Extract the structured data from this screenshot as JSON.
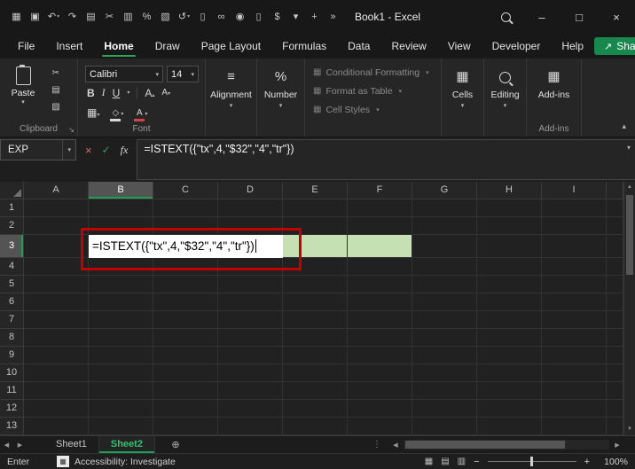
{
  "colors": {
    "accent_green": "#107C41",
    "tab_underline_green": "#2EA158",
    "annotation_red": "#C40000",
    "range_fill_green": "#C6E0B4",
    "share_button_green": "#18894E"
  },
  "ui": {
    "caret_down": "▾",
    "caret_up": "▴",
    "left": "◀",
    "right": "▶",
    "up": "▲",
    "down": "▼",
    "dots": "⋮",
    "launcher": "↘",
    "plus_circle": "⊕",
    "minus": "−",
    "plus": "+",
    "percent": "%",
    "equals": "≡",
    "grid": "▦",
    "border": "▦",
    "diamond": "◇",
    "minimize": "–",
    "maximize": "□",
    "close": "×",
    "share": "↗",
    "view_normal": "▦",
    "view_layout": "▤",
    "view_break": "▥",
    "macro": "▦"
  },
  "title_bar": {
    "title": "Book1 - Excel",
    "quick_access": [
      {
        "name": "app-menu-icon",
        "glyph": "▦"
      },
      {
        "name": "save-icon",
        "glyph": "▣"
      },
      {
        "name": "undo-icon",
        "glyph": "↶",
        "caret": true
      },
      {
        "name": "redo-icon",
        "glyph": "↷"
      },
      {
        "name": "copy-icon",
        "glyph": "▤"
      },
      {
        "name": "cut-icon",
        "glyph": "✂"
      },
      {
        "name": "clipboard-icon",
        "glyph": "▥"
      },
      {
        "name": "percent-icon",
        "glyph": "%"
      },
      {
        "name": "format-painter-icon",
        "glyph": "▧"
      },
      {
        "name": "undo-history-icon",
        "glyph": "↺",
        "caret": true
      },
      {
        "name": "document-icon",
        "glyph": "▯"
      },
      {
        "name": "link-icon",
        "glyph": "∞"
      },
      {
        "name": "camera-icon",
        "glyph": "◉"
      },
      {
        "name": "file-icon",
        "glyph": "▯"
      },
      {
        "name": "currency-icon",
        "glyph": "$"
      },
      {
        "name": "chevron-down-icon",
        "glyph": "▾"
      },
      {
        "name": "add-person-icon",
        "glyph": "+"
      },
      {
        "name": "overflow-icon",
        "glyph": "»"
      }
    ]
  },
  "tabs_row": {
    "tabs": [
      "File",
      "Insert",
      "Home",
      "Draw",
      "Page Layout",
      "Formulas",
      "Data",
      "Review",
      "View",
      "Developer",
      "Help"
    ],
    "active": "Home",
    "share_label": "Share"
  },
  "ribbon": {
    "clipboard": {
      "paste_label": "Paste",
      "caption": "Clipboard",
      "tools": [
        {
          "name": "cut-icon",
          "glyph": "✂"
        },
        {
          "name": "copy-icon",
          "glyph": "▤"
        },
        {
          "name": "format-painter-icon",
          "glyph": "▧"
        }
      ]
    },
    "font": {
      "caption": "Font",
      "font_name": "Calibri",
      "font_size": "14",
      "bold": "B",
      "italic": "I",
      "underline": "U",
      "grow": "A",
      "shrink": "A",
      "color_letter": "A"
    },
    "alignment": {
      "label": "Alignment"
    },
    "number": {
      "label": "Number"
    },
    "styles": {
      "items": [
        "Conditional Formatting",
        "Format as Table",
        "Cell Styles"
      ]
    },
    "cells": {
      "label": "Cells"
    },
    "editing": {
      "label": "Editing"
    },
    "addins": {
      "label": "Add-ins",
      "caption": "Add-ins"
    }
  },
  "formula_bar": {
    "name_box": "EXP",
    "cancel": "×",
    "enter": "✓",
    "fx": "fx",
    "formula": "=ISTEXT({\"tx\",4,\"$32\",\"4\",\"tr\"})"
  },
  "grid": {
    "columns": [
      "A",
      "B",
      "C",
      "D",
      "E",
      "F",
      "G",
      "H",
      "I"
    ],
    "rows": [
      "1",
      "2",
      "3",
      "4",
      "5",
      "6",
      "7",
      "8",
      "9",
      "10",
      "11",
      "12",
      "13"
    ],
    "selected_column": "B",
    "selected_row": "3",
    "edit_cell": "B3",
    "edit_text": "=ISTEXT({\"tx\",4,\"$32\",\"4\",\"tr\"})",
    "fill_range": "B3:F3",
    "green_visible_cells": [
      "E3",
      "F3"
    ]
  },
  "sheet_bar": {
    "tabs": [
      {
        "label": "Sheet1",
        "active": false
      },
      {
        "label": "Sheet2",
        "active": true
      }
    ]
  },
  "status_bar": {
    "mode": "Enter",
    "accessibility": "Accessibility: Investigate",
    "zoom": "100%"
  }
}
